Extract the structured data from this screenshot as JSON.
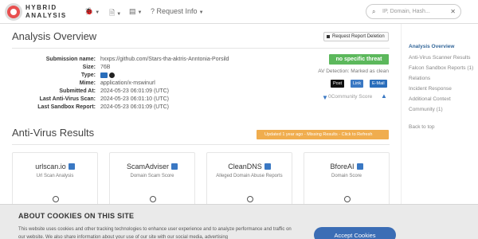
{
  "brand": {
    "line1": "HYBRID",
    "line2": "ANALYSIS"
  },
  "nav": {
    "request_info": "Request Info"
  },
  "search": {
    "placeholder": "IP, Domain, Hash..."
  },
  "overview": {
    "title": "Analysis Overview",
    "delete_button": "Request Report Deletion",
    "fields": [
      {
        "label": "Submission name:",
        "value": "hxxps://github.com/Stars-tha-aktris-Anntonia-Porsild"
      },
      {
        "label": "Size:",
        "value": "76B"
      },
      {
        "label": "Type:",
        "value": ""
      },
      {
        "label": "Mime:",
        "value": "application/x-mswinurl"
      },
      {
        "label": "Submitted At:",
        "value": "2024-05-23 06:01:09 (UTC)"
      },
      {
        "label": "Last Anti-Virus Scan:",
        "value": "2024-05-23 06:01:10 (UTC)"
      },
      {
        "label": "Last Sandbox Report:",
        "value": "2024-05-23 06:01:09 (UTC)"
      }
    ],
    "type_badge": "url",
    "verdict": "no specific threat",
    "av_detection": "AV Detection: Marked as clean",
    "share": {
      "x": "Post",
      "link": "Link",
      "email": "E-Mail"
    },
    "community_score": "0Community Score",
    "thumb_left": "0",
    "thumb_right": "0"
  },
  "sidebar": {
    "items": [
      "Analysis Overview",
      "Anti-Virus Scanner Results",
      "Falcon Sandbox Reports (1)",
      "Relations",
      "Incident Response",
      "Additional Context",
      "Community (1)",
      "Back to top"
    ]
  },
  "av": {
    "title": "Anti-Virus Results",
    "update_banner": "Updated 1 year ago - Missing Results - Click to Refresh",
    "cards": [
      {
        "title": "urlscan.io",
        "subtitle": "Url Scan Analysis"
      },
      {
        "title": "ScamAdviser",
        "subtitle": "Domain Scam Score"
      },
      {
        "title": "CleanDNS",
        "subtitle": "Alleged Domain Abuse Reports"
      },
      {
        "title": "BforeAI",
        "subtitle": "Domain Score"
      }
    ]
  },
  "cookie": {
    "title": "ABOUT COOKIES ON THIS SITE",
    "text": "This website uses cookies and other tracking technologies to enhance user experience and to analyze performance and traffic on our website. We also share information about your use of our site with our social media, advertising",
    "accept": "Accept Cookies"
  },
  "colors": {
    "accent": "#3b6db5",
    "verdict": "#5cb85c",
    "banner": "#f0ad4e",
    "logo": "#e84f4f"
  },
  "icons": [
    "bug-icon",
    "document-icon",
    "database-icon",
    "question-circle-icon",
    "search-icon",
    "close-icon",
    "external-link-icon",
    "spinner-icon",
    "thumbs-down-icon",
    "thumbs-up-icon"
  ]
}
